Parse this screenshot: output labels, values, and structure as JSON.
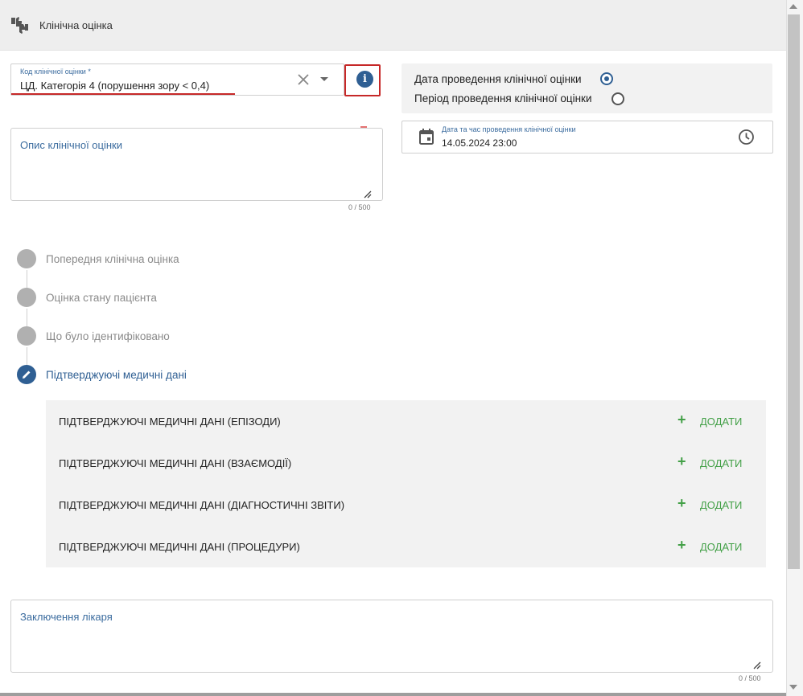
{
  "header": {
    "title": "Клінічна оцінка",
    "icon": "thumbs-up-down-icon"
  },
  "form": {
    "code": {
      "label": "Код клінічної оцінки *",
      "value": "ЦД. Категорія 4 (порушення зору < 0,4)"
    },
    "date_mode": {
      "options": [
        {
          "label": "Дата проведення клінічної оцінки",
          "checked": true
        },
        {
          "label": "Період проведення клінічної оцінки",
          "checked": false
        }
      ]
    },
    "datetime": {
      "label": "Дата та час проведення клінічної оцінки",
      "value": "14.05.2024 23:00"
    },
    "description": {
      "placeholder": "Опис клінічної оцінки",
      "counter": "0 / 500"
    },
    "conclusion": {
      "placeholder": "Заключення лікаря",
      "counter": "0 / 500"
    }
  },
  "stepper": {
    "steps": [
      {
        "label": "Попередня клінічна оцінка",
        "active": false
      },
      {
        "label": "Оцінка стану пацієнта",
        "active": false
      },
      {
        "label": "Що було ідентифіковано",
        "active": false
      },
      {
        "label": "Підтверджуючі медичні дані",
        "active": true
      }
    ]
  },
  "evidence": {
    "rows": [
      {
        "label": "ПІДТВЕРДЖУЮЧІ МЕДИЧНІ ДАНІ (ЕПІЗОДИ)",
        "action": "ДОДАТИ"
      },
      {
        "label": "ПІДТВЕРДЖУЮЧІ МЕДИЧНІ ДАНІ (ВЗАЄМОДІЇ)",
        "action": "ДОДАТИ"
      },
      {
        "label": "ПІДТВЕРДЖУЮЧІ МЕДИЧНІ ДАНІ (ДІАГНОСТИЧНІ ЗВІТИ)",
        "action": "ДОДАТИ"
      },
      {
        "label": "ПІДТВЕРДЖУЮЧІ МЕДИЧНІ ДАНІ (ПРОЦЕДУРИ)",
        "action": "ДОДАТИ"
      }
    ]
  },
  "colors": {
    "accent": "#2f5f93",
    "error": "#c62828",
    "add": "#43a047",
    "panel": "#f2f2f2"
  }
}
